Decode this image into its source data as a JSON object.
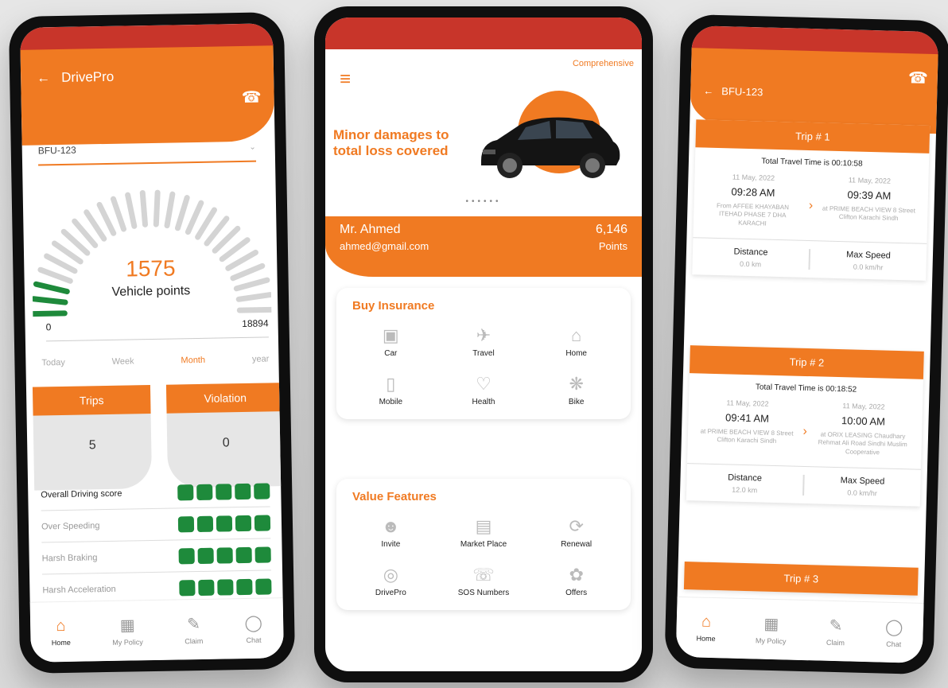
{
  "left_phone": {
    "title": "DrivePro",
    "vehicle_select": "BFU-123",
    "points": "1575",
    "points_label": "Vehicle points",
    "min": "0",
    "max": "18894",
    "periods": [
      "Today",
      "Week",
      "Month",
      "year"
    ],
    "active_period": "Month",
    "trips_label": "Trips",
    "trips_value": "5",
    "violation_label": "Violation",
    "violation_value": "0",
    "scores": [
      {
        "label": "Overall Driving score",
        "rating": 5
      },
      {
        "label": "Over Speeding",
        "rating": 5
      },
      {
        "label": "Harsh Braking",
        "rating": 5
      },
      {
        "label": "Harsh Acceleration",
        "rating": 5
      }
    ],
    "nav": [
      "Home",
      "My Policy",
      "Claim",
      "Chat"
    ]
  },
  "center_phone": {
    "plan_label": "Comprehensive",
    "banner_text": "Minor damages to total loss covered",
    "pager": "••••••",
    "user_name": "Mr. Ahmed",
    "user_email": "ahmed@gmail.com",
    "points_value": "6,146",
    "points_label": "Points",
    "buy_title": "Buy Insurance",
    "buy_items": [
      {
        "label": "Car",
        "icon": "car-icon"
      },
      {
        "label": "Travel",
        "icon": "plane-icon"
      },
      {
        "label": "Home",
        "icon": "home-icon"
      },
      {
        "label": "Mobile",
        "icon": "mobile-icon"
      },
      {
        "label": "Health",
        "icon": "heart-pulse-icon"
      },
      {
        "label": "Bike",
        "icon": "bike-icon"
      }
    ],
    "value_title": "Value Features",
    "value_items": [
      {
        "label": "Invite",
        "icon": "user-plus-icon"
      },
      {
        "label": "Market Place",
        "icon": "store-icon"
      },
      {
        "label": "Renewal",
        "icon": "refresh-icon"
      },
      {
        "label": "DrivePro",
        "icon": "steering-icon"
      },
      {
        "label": "SOS Numbers",
        "icon": "sos-icon"
      },
      {
        "label": "Offers",
        "icon": "gift-icon"
      }
    ]
  },
  "right_phone": {
    "title": "BFU-123",
    "trips": [
      {
        "header": "Trip # 1",
        "total": "Total Travel Time is 00:10:58",
        "from_date": "11 May, 2022",
        "from_time": "09:28 AM",
        "from_addr": "From AFFEE KHAYABAN ITEHAD PHASE 7 DHA KARACHI",
        "to_date": "11 May, 2022",
        "to_time": "09:39 AM",
        "to_addr": "at PRIME BEACH VIEW 8 Street Clifton Karachi Sindh",
        "distance_label": "Distance",
        "distance": "0.0 km",
        "speed_label": "Max Speed",
        "speed": "0.0 km/hr"
      },
      {
        "header": "Trip # 2",
        "total": "Total Travel Time is 00:18:52",
        "from_date": "11 May, 2022",
        "from_time": "09:41 AM",
        "from_addr": "at PRIME BEACH VIEW 8 Street Clifton Karachi Sindh",
        "to_date": "11 May, 2022",
        "to_time": "10:00 AM",
        "to_addr": "at ORIX LEASING Chaudhary Rehmat Ali Road Sindhi Muslim Cooperative",
        "distance_label": "Distance",
        "distance": "12.0 km",
        "speed_label": "Max Speed",
        "speed": "0.0 km/hr"
      }
    ],
    "trip3_header": "Trip # 3",
    "nav": [
      "Home",
      "My Policy",
      "Claim",
      "Chat"
    ]
  },
  "colors": {
    "accent": "#f07a22",
    "status_bar": "#c8352a",
    "score_green": "#1e8a3b"
  }
}
